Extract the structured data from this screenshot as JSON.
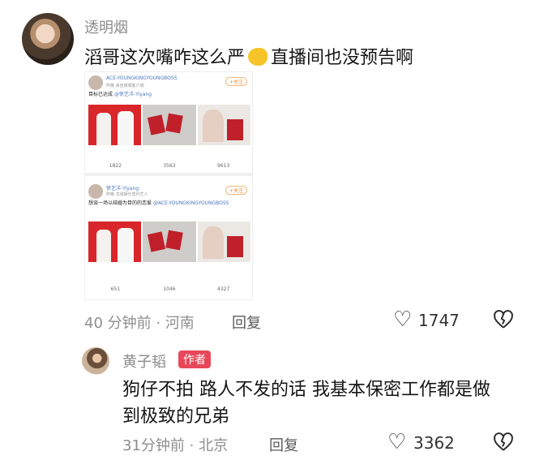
{
  "comment": {
    "username": "透明烟",
    "text_part1": "滔哥这次嘴咋这么严",
    "emoji": "muscle-emoji",
    "text_part2": "直播间也没预告啊",
    "meta": "40 分钟前 · 河南",
    "reply_label": "回复",
    "like_count": "1747"
  },
  "embedded_image": {
    "post1": {
      "name": "ACE-YOUNGKINGYOUNGBOSS",
      "sub": "昨晚 来自微博客户端",
      "follow": "+关注",
      "text": "目标已达成",
      "mention": "@徐艺洋-Yiyang",
      "stats": [
        "1822",
        "3563",
        "9613"
      ]
    },
    "post2": {
      "name": "徐艺洋-Yiyang",
      "sub": "昨晚 龙城娱乐签约艺人",
      "follow": "+关注",
      "text": "想谈一场以结婚为目的的恋爱",
      "mention": "@ACE-YOUNGKINGYOUNGBOSS",
      "stats": [
        "651",
        "1046",
        "4327"
      ]
    }
  },
  "reply": {
    "username": "黄子韬",
    "badge": "作者",
    "text": "狗仔不拍 路人不发的话 我基本保密工作都是做到极致的兄弟",
    "meta": "31分钟前 · 北京",
    "reply_label": "回复",
    "like_count": "3362"
  },
  "icons": {
    "like": "heart-outline-icon",
    "dislike": "broken-heart-icon"
  },
  "colors": {
    "badge": "#e8475a",
    "meta_text": "#8e8e8e",
    "link_blue": "#4b77be"
  }
}
